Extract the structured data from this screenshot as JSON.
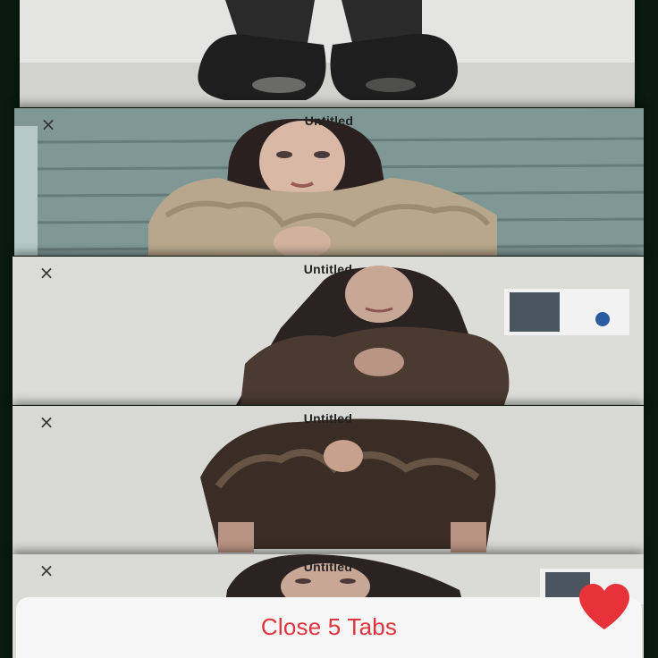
{
  "tabs": [
    {
      "title": "",
      "close_icon": "×",
      "thumbnail": "feet in patterned tights and black shoes"
    },
    {
      "title": "Untitled",
      "close_icon": "×"
    },
    {
      "title": "Untitled",
      "close_icon": "×"
    },
    {
      "title": "Untitled",
      "close_icon": "×"
    },
    {
      "title": "Untitled",
      "close_icon": "×"
    }
  ],
  "action_bar": {
    "close_tabs_label": "Close 5 Tabs"
  },
  "colors": {
    "accent_red": "#e0343c",
    "heart_red": "#e8323a",
    "bar_bg": "#f6f6f6"
  },
  "icons": {
    "tab_close": "close-icon",
    "favorite": "heart-icon"
  }
}
